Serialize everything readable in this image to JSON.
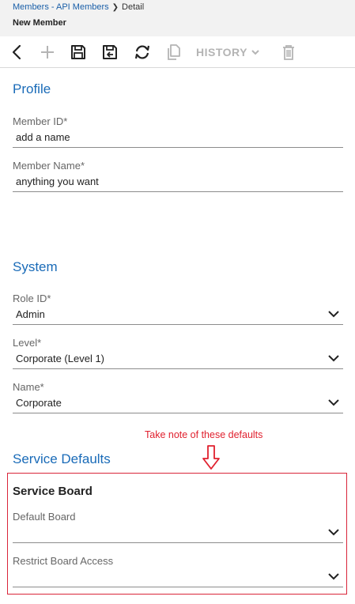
{
  "breadcrumb": {
    "link": "Members - API Members",
    "current": "Detail"
  },
  "page_title": "New Member",
  "toolbar": {
    "history_label": "HISTORY",
    "icons": [
      "back-arrow",
      "add",
      "save",
      "save-and-close",
      "refresh",
      "copy",
      "history-dropdown",
      "delete"
    ]
  },
  "profile": {
    "title": "Profile",
    "member_id": {
      "label": "Member ID*",
      "value": "add a name"
    },
    "member_name": {
      "label": "Member Name*",
      "value": "anything you want"
    }
  },
  "system": {
    "title": "System",
    "role_id": {
      "label": "Role ID*",
      "value": "Admin"
    },
    "level": {
      "label": "Level*",
      "value": "Corporate (Level 1)"
    },
    "name": {
      "label": "Name*",
      "value": "Corporate"
    }
  },
  "annotation": {
    "text": "Take note of these defaults",
    "color": "#e0202e"
  },
  "service_defaults": {
    "title": "Service Defaults",
    "subsection": "Service Board",
    "default_board": {
      "label": "Default Board",
      "value": ""
    },
    "restrict_board_access": {
      "label": "Restrict Board Access",
      "value": ""
    }
  },
  "colors": {
    "accent": "#1a6bb8",
    "header_bg": "#f2f2f2",
    "highlight": "#d9253a"
  }
}
